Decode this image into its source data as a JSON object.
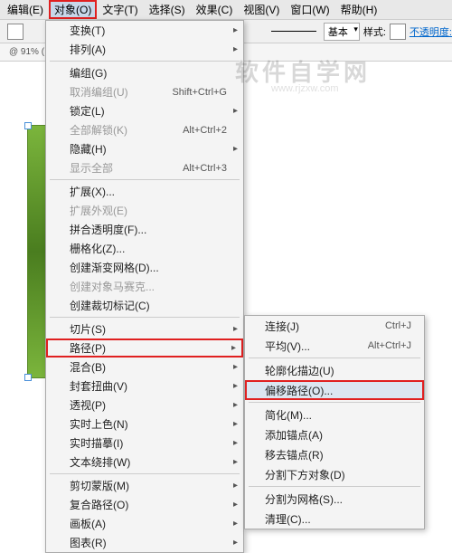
{
  "menubar": {
    "items": [
      "编辑(E)",
      "对象(O)",
      "文字(T)",
      "选择(S)",
      "效果(C)",
      "视图(V)",
      "窗口(W)",
      "帮助(H)"
    ]
  },
  "toolbar": {
    "stroke_label": "基本",
    "style_label": "样式:",
    "opacity_label": "不透明度:"
  },
  "ruler": {
    "zoom": "@ 91% ("
  },
  "menu1": {
    "items": [
      {
        "label": "变换(T)",
        "sub": true
      },
      {
        "label": "排列(A)",
        "sub": true
      },
      {
        "sep": true
      },
      {
        "label": "编组(G)"
      },
      {
        "label": "取消编组(U)",
        "sc": "Shift+Ctrl+G",
        "dis": true
      },
      {
        "label": "锁定(L)",
        "sub": true
      },
      {
        "label": "全部解锁(K)",
        "sc": "Alt+Ctrl+2",
        "dis": true
      },
      {
        "label": "隐藏(H)",
        "sub": true
      },
      {
        "label": "显示全部",
        "sc": "Alt+Ctrl+3",
        "dis": true
      },
      {
        "sep": true
      },
      {
        "label": "扩展(X)..."
      },
      {
        "label": "扩展外观(E)",
        "dis": true
      },
      {
        "label": "拼合透明度(F)..."
      },
      {
        "label": "栅格化(Z)..."
      },
      {
        "label": "创建渐变网格(D)..."
      },
      {
        "label": "创建对象马赛克...",
        "dis": true
      },
      {
        "label": "创建裁切标记(C)"
      },
      {
        "sep": true
      },
      {
        "label": "切片(S)",
        "sub": true
      },
      {
        "label": "路径(P)",
        "sub": true,
        "hl": true
      },
      {
        "label": "混合(B)",
        "sub": true
      },
      {
        "label": "封套扭曲(V)",
        "sub": true
      },
      {
        "label": "透视(P)",
        "sub": true
      },
      {
        "label": "实时上色(N)",
        "sub": true
      },
      {
        "label": "实时描摹(I)",
        "sub": true
      },
      {
        "label": "文本绕排(W)",
        "sub": true
      },
      {
        "sep": true
      },
      {
        "label": "剪切蒙版(M)",
        "sub": true
      },
      {
        "label": "复合路径(O)",
        "sub": true
      },
      {
        "label": "画板(A)",
        "sub": true
      },
      {
        "label": "图表(R)",
        "sub": true
      }
    ]
  },
  "menu2": {
    "items": [
      {
        "label": "连接(J)",
        "sc": "Ctrl+J"
      },
      {
        "label": "平均(V)...",
        "sc": "Alt+Ctrl+J"
      },
      {
        "sep": true
      },
      {
        "label": "轮廓化描边(U)"
      },
      {
        "label": "偏移路径(O)...",
        "hl": true
      },
      {
        "sep": true
      },
      {
        "label": "简化(M)..."
      },
      {
        "label": "添加锚点(A)"
      },
      {
        "label": "移去锚点(R)"
      },
      {
        "label": "分割下方对象(D)"
      },
      {
        "sep": true
      },
      {
        "label": "分割为网格(S)..."
      },
      {
        "label": "清理(C)..."
      }
    ]
  },
  "watermark": {
    "main": "软件自学网",
    "sub": "www.rjzxw.com"
  }
}
